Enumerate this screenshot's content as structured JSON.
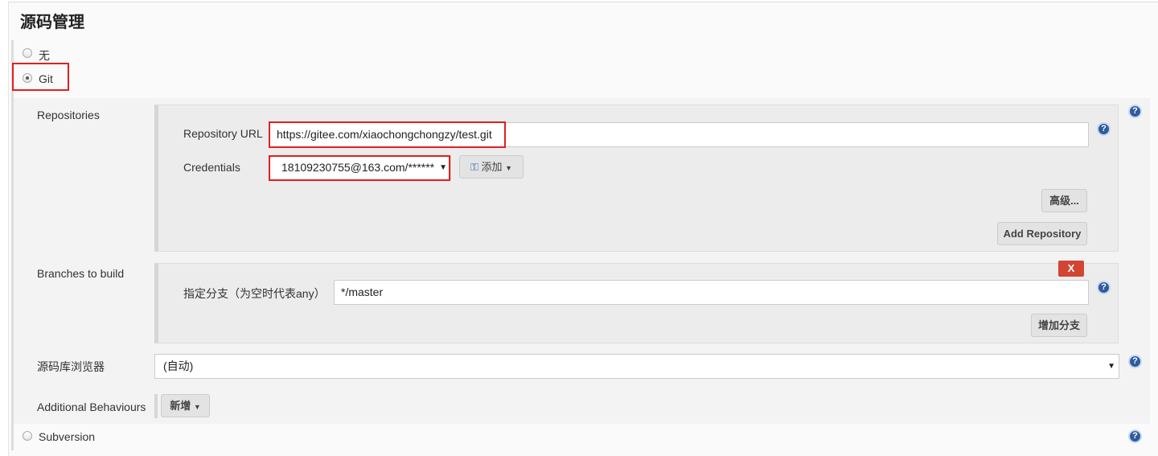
{
  "section_title": "源码管理",
  "scm_options": [
    {
      "label": "无",
      "selected": false
    },
    {
      "label": "Git",
      "selected": true
    },
    {
      "label": "Subversion",
      "selected": false
    }
  ],
  "repositories": {
    "label": "Repositories",
    "url_label": "Repository URL",
    "url_value": "https://gitee.com/xiaochongchongzy/test.git",
    "credentials_label": "Credentials",
    "credentials_value": "18109230755@163.com/******",
    "add_label": "添加",
    "advanced_label": "高级...",
    "add_repository_label": "Add Repository"
  },
  "branches": {
    "label": "Branches to build",
    "branch_label": "指定分支（为空时代表any）",
    "branch_value": "*/master",
    "delete_label": "X",
    "add_branch_label": "增加分支"
  },
  "browser": {
    "label": "源码库浏览器",
    "value": "(自动)"
  },
  "behaviours": {
    "label": "Additional Behaviours",
    "add_label": "新增"
  },
  "colors": {
    "highlight": "#e0201f",
    "help": "#2e5c9e",
    "delete": "#d24533"
  }
}
